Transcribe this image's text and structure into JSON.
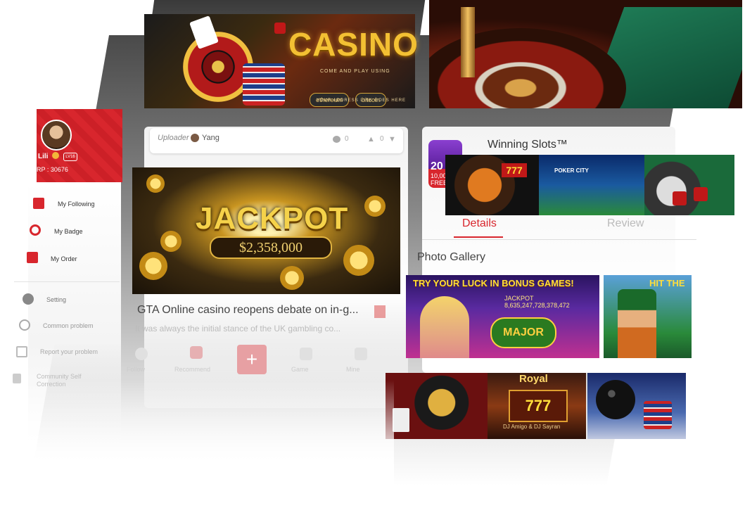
{
  "banners": {
    "casino_title": "CASINO",
    "casino_sub": "COME AND PLAY USING",
    "coin_1": "ethereum",
    "coin_2": "bitcoin",
    "casino_addr": "YOUR ADDRESS LINK GOES HERE"
  },
  "sidebar": {
    "user_name": "Lili",
    "level_badge": "LV16",
    "rp_text": "RP : 30676",
    "items": [
      {
        "label": "My Following",
        "icon": "bookmark-plus-icon"
      },
      {
        "label": "My Badge",
        "icon": "badge-icon"
      },
      {
        "label": "My Order",
        "icon": "order-list-icon"
      },
      {
        "label": "Setting",
        "icon": "gear-icon"
      },
      {
        "label": "Common problem",
        "icon": "question-icon"
      },
      {
        "label": "Report your problem",
        "icon": "edit-icon"
      },
      {
        "label": "Community Self Correction",
        "icon": "document-icon"
      }
    ],
    "accent_color": "#d8262d"
  },
  "feed": {
    "uploader_label": "Uploader",
    "uploader_name": "Yang",
    "comments": "0",
    "votes": "0",
    "jackpot_title": "JACKPOT",
    "jackpot_amount": "$2,358,000",
    "headline": "GTA Online casino reopens debate on in-g...",
    "snippet": "It was always the initial stance of the UK gambling co...",
    "tabs": [
      {
        "label": "Follow",
        "icon": "heart-icon"
      },
      {
        "label": "Recommend",
        "icon": "star-bookmark-icon"
      },
      {
        "label": "",
        "icon": "plus-icon"
      },
      {
        "label": "Game",
        "icon": "dice-icon"
      },
      {
        "label": "Mine",
        "icon": "clipboard-check-icon"
      }
    ],
    "plus_label": "+"
  },
  "detail": {
    "app_name": "Winning Slots™",
    "app_icon_text": "20",
    "app_icon_sub": "10,00",
    "app_icon_free": "FREE",
    "tab_details": "Details",
    "tab_review": "Review",
    "gallery_title": "Photo Gallery",
    "bonus_header": "TRY YOUR LUCK IN BONUS GAMES!",
    "bonus_jackpot": "JACKPOT 8,635,247,728,378,472",
    "bonus_major": "MAJOR",
    "hit_header": "HIT THE",
    "thumb_poker": "POKER CITY",
    "mini_royal": "Royal",
    "mini_royal_sub": "DJ Amigo & DJ Sayran"
  }
}
